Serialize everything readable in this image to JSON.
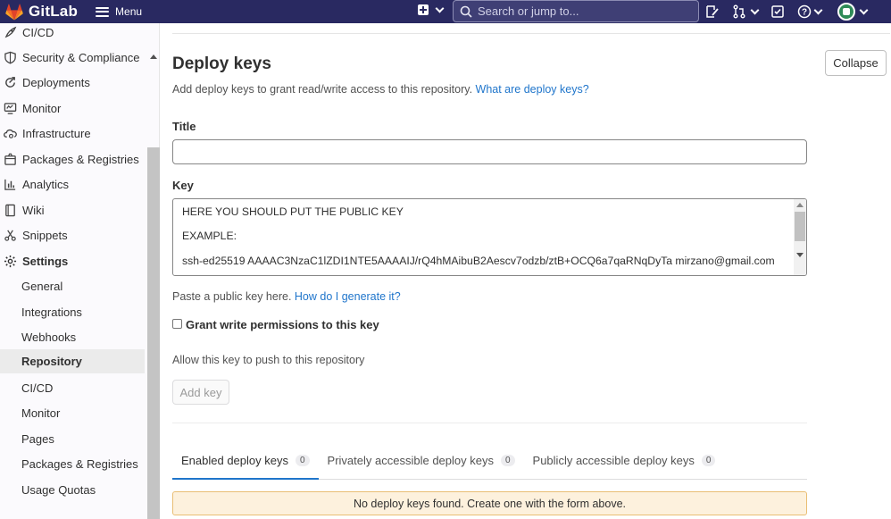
{
  "topbar": {
    "brand": "GitLab",
    "menu_label": "Menu",
    "search_placeholder": "Search or jump to..."
  },
  "sidebar": {
    "items": [
      {
        "label": "CI/CD",
        "icon": "rocket-icon"
      },
      {
        "label": "Security & Compliance",
        "icon": "shield-icon"
      },
      {
        "label": "Deployments",
        "icon": "deployments-icon"
      },
      {
        "label": "Monitor",
        "icon": "monitor-icon"
      },
      {
        "label": "Infrastructure",
        "icon": "cloud-gear-icon"
      },
      {
        "label": "Packages & Registries",
        "icon": "package-icon"
      },
      {
        "label": "Analytics",
        "icon": "chart-icon"
      },
      {
        "label": "Wiki",
        "icon": "book-icon"
      },
      {
        "label": "Snippets",
        "icon": "scissors-icon"
      },
      {
        "label": "Settings",
        "icon": "gear-icon"
      }
    ],
    "settings_sub": [
      {
        "label": "General"
      },
      {
        "label": "Integrations"
      },
      {
        "label": "Webhooks"
      },
      {
        "label": "Repository"
      },
      {
        "label": "CI/CD"
      },
      {
        "label": "Monitor"
      },
      {
        "label": "Pages"
      },
      {
        "label": "Packages & Registries"
      },
      {
        "label": "Usage Quotas"
      }
    ]
  },
  "main": {
    "heading": "Deploy keys",
    "description": "Add deploy keys to grant read/write access to this repository.",
    "description_link": "What are deploy keys?",
    "collapse_label": "Collapse",
    "title_label": "Title",
    "title_value": "",
    "key_label": "Key",
    "key_lines": [
      "HERE YOU SHOULD PUT THE PUBLIC KEY",
      "EXAMPLE:",
      "ssh-ed25519 AAAAC3NzaC1lZDI1NTE5AAAAIJ/rQ4hMAibuB2Aescv7odzb/ztB+OCQ6a7qaRNqDyTa mirzano@gmail.com"
    ],
    "help_text": "Paste a public key here.",
    "help_link": "How do I generate it?",
    "grant_label": "Grant write permissions to this key",
    "allow_text": "Allow this key to push to this repository",
    "add_key_label": "Add key",
    "tabs": [
      {
        "label": "Enabled deploy keys",
        "count": "0"
      },
      {
        "label": "Privately accessible deploy keys",
        "count": "0"
      },
      {
        "label": "Publicly accessible deploy keys",
        "count": "0"
      }
    ],
    "empty_message": "No deploy keys found. Create one with the form above."
  }
}
